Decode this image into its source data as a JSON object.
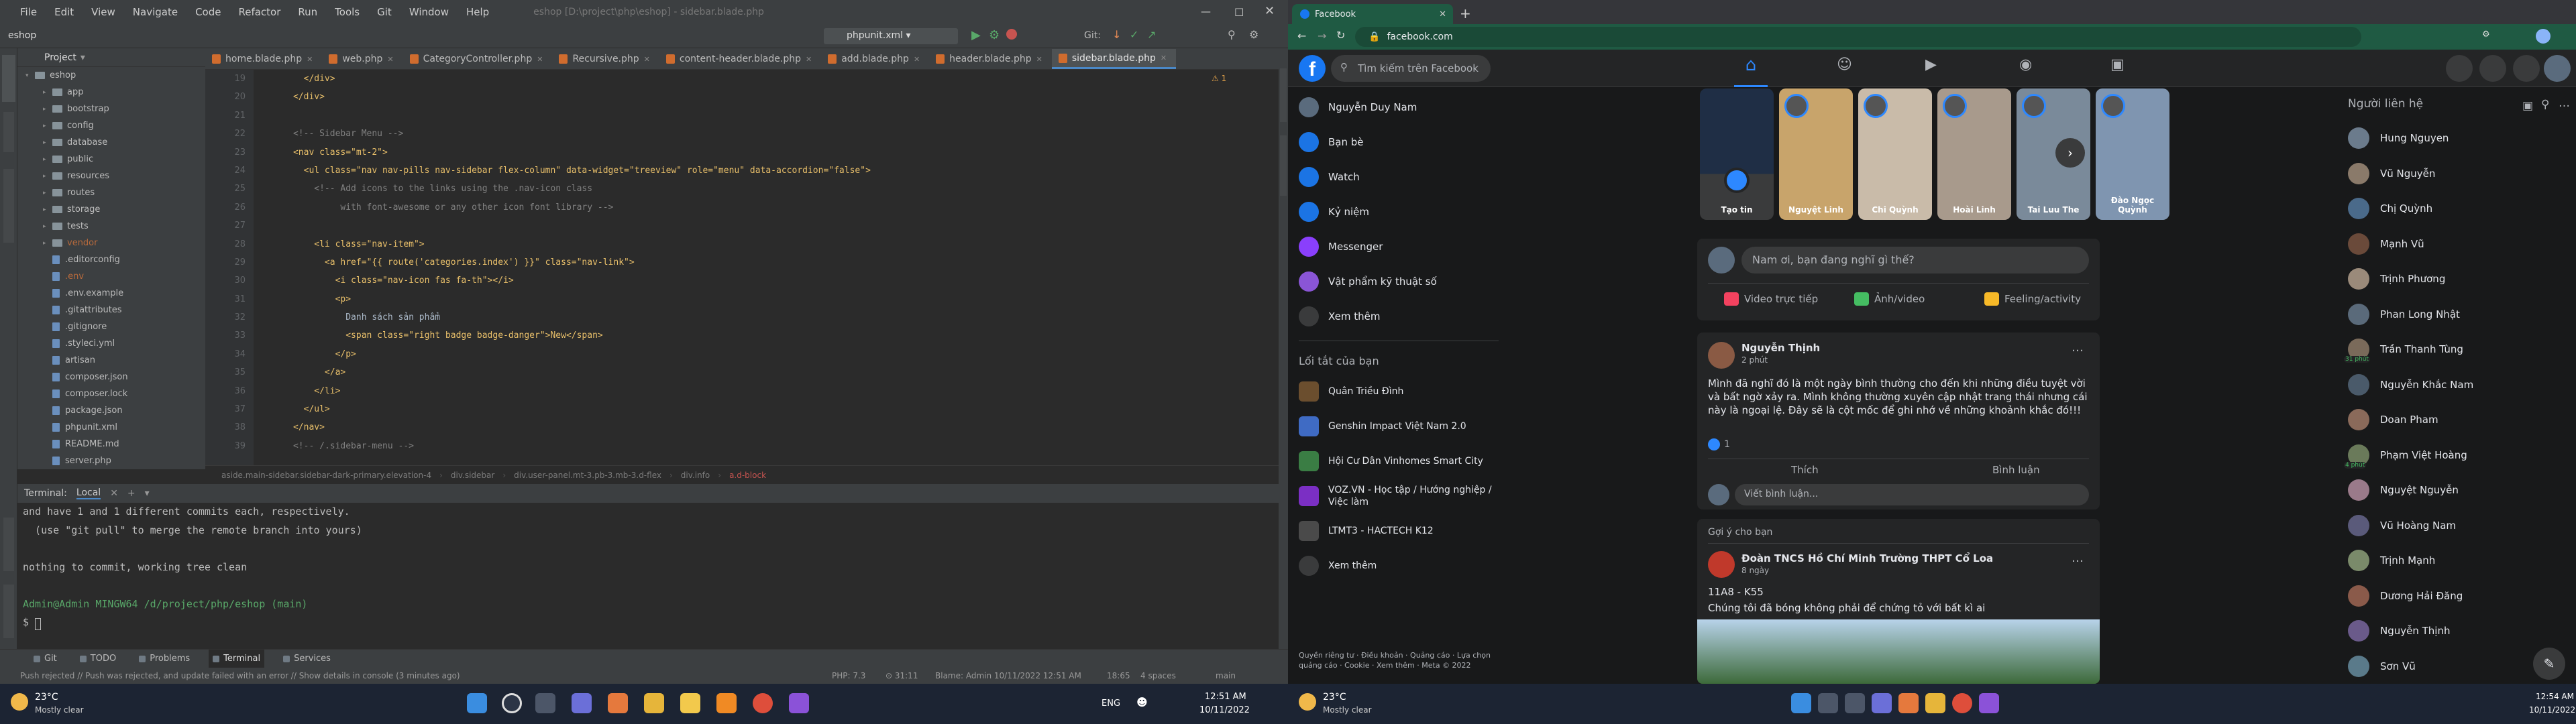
{
  "ide": {
    "menu": [
      "File",
      "Edit",
      "View",
      "Navigate",
      "Code",
      "Refactor",
      "Run",
      "Tools",
      "Git",
      "Window",
      "Help"
    ],
    "window_title": "eshop [D:\\project\\php\\eshop] - sidebar.blade.php",
    "project_name": "eshop",
    "run_config": "phpunit.xml",
    "git_label": "Git:",
    "project_label": "Project",
    "tree": [
      {
        "label": "eshop",
        "type": "folder",
        "depth": 0
      },
      {
        "label": "app",
        "type": "folder",
        "depth": 1
      },
      {
        "label": "bootstrap",
        "type": "folder",
        "depth": 1
      },
      {
        "label": "config",
        "type": "folder",
        "depth": 1
      },
      {
        "label": "database",
        "type": "folder",
        "depth": 1
      },
      {
        "label": "public",
        "type": "folder",
        "depth": 1
      },
      {
        "label": "resources",
        "type": "folder",
        "depth": 1
      },
      {
        "label": "routes",
        "type": "folder",
        "depth": 1
      },
      {
        "label": "storage",
        "type": "folder",
        "depth": 1
      },
      {
        "label": "tests",
        "type": "folder",
        "depth": 1
      },
      {
        "label": "vendor",
        "type": "folder",
        "depth": 1
      },
      {
        "label": ".editorconfig",
        "type": "file",
        "depth": 1
      },
      {
        "label": ".env",
        "type": "file",
        "depth": 1
      },
      {
        "label": ".env.example",
        "type": "file",
        "depth": 1
      },
      {
        "label": ".gitattributes",
        "type": "file",
        "depth": 1
      },
      {
        "label": ".gitignore",
        "type": "file",
        "depth": 1
      },
      {
        "label": ".styleci.yml",
        "type": "file",
        "depth": 1
      },
      {
        "label": "artisan",
        "type": "file",
        "depth": 1
      },
      {
        "label": "composer.json",
        "type": "file",
        "depth": 1
      },
      {
        "label": "composer.lock",
        "type": "file",
        "depth": 1
      },
      {
        "label": "package.json",
        "type": "file",
        "depth": 1
      },
      {
        "label": "phpunit.xml",
        "type": "file",
        "depth": 1
      },
      {
        "label": "README.md",
        "type": "file",
        "depth": 1
      },
      {
        "label": "server.php",
        "type": "file",
        "depth": 1
      }
    ],
    "tabs": [
      "home.blade.php",
      "web.php",
      "CategoryController.php",
      "Recursive.php",
      "content-header.blade.php",
      "add.blade.php",
      "header.blade.php",
      "sidebar.blade.php"
    ],
    "line_numbers": [
      "19",
      "20",
      "21",
      "22",
      "23",
      "24",
      "25",
      "26",
      "27",
      "28",
      "29",
      "30",
      "31",
      "32",
      "33",
      "34",
      "35",
      "36",
      "37",
      "38",
      "39"
    ],
    "code": [
      "        </div>",
      "      </div>",
      "",
      "      <!-- Sidebar Menu -->",
      "      <nav class=\"mt-2\">",
      "        <ul class=\"nav nav-pills nav-sidebar flex-column\" data-widget=\"treeview\" role=\"menu\" data-accordion=\"false\">",
      "          <!-- Add icons to the links using the .nav-icon class",
      "               with font-awesome or any other icon font library -->",
      "",
      "          <li class=\"nav-item\">",
      "            <a href=\"{{ route('categories.index') }}\" class=\"nav-link\">",
      "              <i class=\"nav-icon fas fa-th\"></i>",
      "              <p>",
      "                Danh sách sản phẩm",
      "                <span class=\"right badge badge-danger\">New</span>",
      "              </p>",
      "            </a>",
      "          </li>",
      "        </ul>",
      "      </nav>",
      "      <!-- /.sidebar-menu -->"
    ],
    "breadcrumb": [
      "aside.main-sidebar.sidebar-dark-primary.elevation-4",
      "div.sidebar",
      "div.user-panel.mt-3.pb-3.mb-3.d-flex",
      "div.info",
      "a.d-block"
    ],
    "terminal_tabs": [
      "Terminal:",
      "Local"
    ],
    "terminal": [
      "and have 1 and 1 different commits each, respectively.",
      "  (use \"git pull\" to merge the remote branch into yours)",
      "",
      "nothing to commit, working tree clean",
      "",
      "Admin@Admin MINGW64 /d/project/php/eshop (main)",
      "$ "
    ],
    "tool_tabs": [
      "Git",
      "TODO",
      "Problems",
      "Terminal",
      "Services"
    ],
    "status_left": "Push rejected // Push was rejected, and update failed with an error // Show details in console (3 minutes ago)",
    "status_right": [
      "PHP: 7.3",
      "⊙ 31:11",
      "Blame: Admin 10/11/2022 12:51 AM",
      "18:65",
      "4 spaces",
      "main"
    ],
    "warning_count": "1"
  },
  "taskbar_left": {
    "temp": "23°C",
    "weather": "Mostly clear",
    "lang": "ENG",
    "time": "12:51 AM",
    "date": "10/11/2022"
  },
  "taskbar_right": {
    "temp": "23°C",
    "weather": "Mostly clear",
    "time": "12:54 AM",
    "date": "10/11/2022"
  },
  "chrome": {
    "tab_title": "Facebook",
    "url": "facebook.com"
  },
  "fb": {
    "search_placeholder": "Tìm kiếm trên Facebook",
    "left": [
      "Nguyễn Duy Nam",
      "Bạn bè",
      "Watch",
      "Kỷ niệm",
      "Messenger",
      "Vật phẩm kỹ thuật số",
      "Xem thêm"
    ],
    "shortcuts_title": "Lối tắt của bạn",
    "shortcuts": [
      "Quân Triều Đình",
      "Genshin Impact Việt Nam 2.0",
      "Hội Cư Dân Vinhomes Smart City",
      "VOZ.VN - Học tập / Hướng nghiệp / Việc làm",
      "LTMT3 - HACTECH K12",
      "Xem thêm"
    ],
    "footer": "Quyền riêng tư · Điều khoản · Quảng cáo · Lựa chọn quảng cáo · Cookie · Xem thêm · Meta © 2022",
    "stories": [
      "Tạo tin",
      "Nguyệt Linh",
      "Chi Quỳnh",
      "Hoài Linh",
      "Tai Luu The",
      "Đào Ngọc Quỳnh"
    ],
    "composer_placeholder": "Nam ơi, bạn đang nghĩ gì thế?",
    "composer_actions": [
      "Video trực tiếp",
      "Ảnh/video",
      "Feeling/activity"
    ],
    "post": {
      "author": "Nguyễn Thịnh",
      "time": "2 phút",
      "text": "Mình đã nghĩ đó là một ngày bình thường cho đến khi những điều tuyệt vời và bất ngờ xảy ra. Mình không thường xuyên cập nhật trang thái nhưng cái này là ngoại lệ. Đây sẽ là cột mốc để ghi nhớ về những khoảnh khắc đó!!!",
      "likes": "1",
      "like_btn": "Thích",
      "comment_btn": "Bình luận",
      "comment_placeholder": "Viết bình luận..."
    },
    "suggested_label": "Gợi ý cho bạn",
    "post2": {
      "author": "Đoàn TNCS Hồ Chí Minh Trường THPT Cổ Loa",
      "time": "8 ngày",
      "class": "11A8 - K55",
      "text": "Chúng tôi đã bóng không phải để chứng tỏ với bất kì ai"
    },
    "contacts_title": "Người liên hệ",
    "contacts": [
      "Hung Nguyen",
      "Vũ Nguyễn",
      "Chị Quỳnh",
      "Mạnh Vũ",
      "Trịnh Phương",
      "Phan Long Nhật",
      "Trần Thanh Tùng",
      "Nguyễn Khắc Nam",
      "Doan Pham",
      "Phạm Việt Hoàng",
      "Nguyệt Nguyễn",
      "Vũ Hoàng Nam",
      "Trịnh Mạnh",
      "Dương Hải Đăng",
      "Nguyễn Thịnh",
      "Sơn Vũ"
    ],
    "contact_badges": {
      "6": "31 phút",
      "9": "4 phút"
    }
  }
}
